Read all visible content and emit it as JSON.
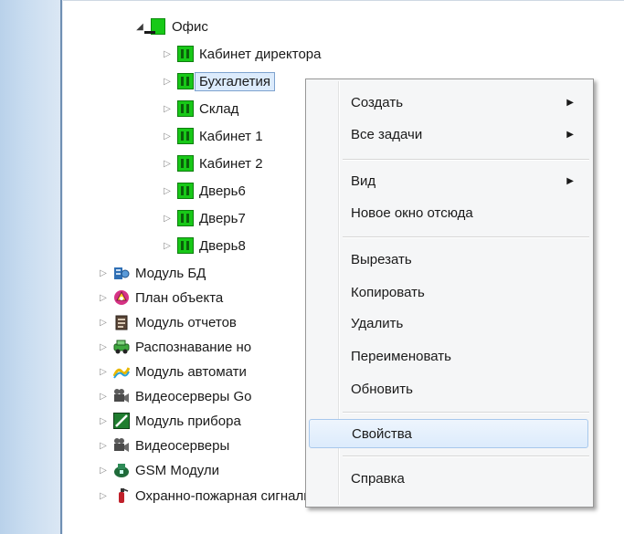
{
  "tree": {
    "office": {
      "label": "Офис",
      "icon": "office-folder-icon",
      "expanded": true
    },
    "office_children": [
      {
        "label": "Кабинет директора",
        "icon": "door-icon"
      },
      {
        "label": "Бухгалетия",
        "icon": "door-icon",
        "selected": true
      },
      {
        "label": "Склад",
        "icon": "door-icon"
      },
      {
        "label": "Кабинет 1",
        "icon": "door-icon"
      },
      {
        "label": "Кабинет 2",
        "icon": "door-icon"
      },
      {
        "label": "Дверь6",
        "icon": "door-icon"
      },
      {
        "label": "Дверь7",
        "icon": "door-icon"
      },
      {
        "label": "Дверь8",
        "icon": "door-icon"
      }
    ],
    "modules": [
      {
        "label": "Модуль БД",
        "icon": "database-module-icon"
      },
      {
        "label": "План объекта",
        "icon": "site-plan-icon"
      },
      {
        "label": "Модуль отчетов",
        "icon": "reports-icon"
      },
      {
        "label": "Распознавание но",
        "icon": "recognition-icon"
      },
      {
        "label": "Модуль автомати",
        "icon": "automation-icon"
      },
      {
        "label": "Видеосерверы Go",
        "icon": "video-server-icon"
      },
      {
        "label": "Модуль прибора",
        "icon": "device-module-icon"
      },
      {
        "label": "Видеосерверы",
        "icon": "video-server-icon"
      },
      {
        "label": "GSM Модули",
        "icon": "gsm-icon"
      },
      {
        "label": "Охранно-пожарная сигнализация",
        "icon": "fire-alarm-icon"
      }
    ]
  },
  "context_menu": {
    "items": [
      {
        "label": "Создать",
        "submenu": true
      },
      {
        "label": "Все задачи",
        "submenu": true
      },
      {
        "label": "Вид",
        "submenu": true
      },
      {
        "label": "Новое окно отсюда",
        "submenu": false
      },
      {
        "label": "Вырезать",
        "submenu": false
      },
      {
        "label": "Копировать",
        "submenu": false
      },
      {
        "label": "Удалить",
        "submenu": false
      },
      {
        "label": "Переименовать",
        "submenu": false
      },
      {
        "label": "Обновить",
        "submenu": false
      },
      {
        "label": "Свойства",
        "submenu": false,
        "highlighted": true
      },
      {
        "label": "Справка",
        "submenu": false
      }
    ],
    "submenu_arrow": "▶"
  },
  "colors": {
    "selection_fill": "#dcebfc",
    "selection_border": "#7da2ce",
    "door_green": "#18c818",
    "menu_background": "#f5f6f7"
  }
}
